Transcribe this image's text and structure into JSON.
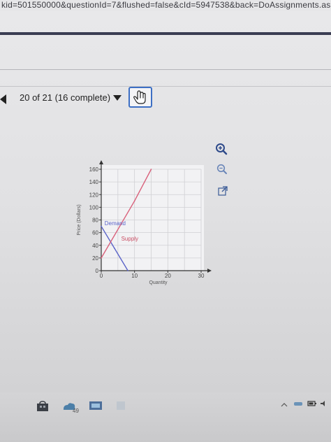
{
  "browser": {
    "url": "kid=501550000&questionId=7&flushed=false&cId=5947538&back=DoAssignments.asp"
  },
  "nav": {
    "question_count": "20 of 21 (16 complete)"
  },
  "chart_data": {
    "type": "line",
    "xlabel": "Quantity",
    "ylabel": "Price (Dollars)",
    "xlim": [
      0,
      30
    ],
    "ylim": [
      0,
      160
    ],
    "xticks": [
      "0",
      "10",
      "20",
      "30"
    ],
    "yticks": [
      "0",
      "20",
      "40",
      "60",
      "80",
      "100",
      "120",
      "140",
      "160"
    ],
    "grid": true,
    "series": [
      {
        "name": "Demand",
        "color": "#5a63c8",
        "points": [
          [
            0,
            70
          ],
          [
            4,
            35
          ],
          [
            8,
            0
          ]
        ]
      },
      {
        "name": "Supply",
        "color": "#d9607a",
        "points": [
          [
            0,
            20
          ],
          [
            10,
            110
          ],
          [
            15,
            160
          ]
        ]
      }
    ],
    "annotations": [
      {
        "text": "Demand",
        "x": 1,
        "y": 75,
        "color": "#5a63c8"
      },
      {
        "text": "Supply",
        "x": 6,
        "y": 51,
        "color": "#c94c62"
      }
    ]
  },
  "tools": [
    "zoom-in-icon",
    "zoom-out-icon",
    "open-new-window-icon"
  ],
  "taskbar": {
    "temp": "49"
  }
}
